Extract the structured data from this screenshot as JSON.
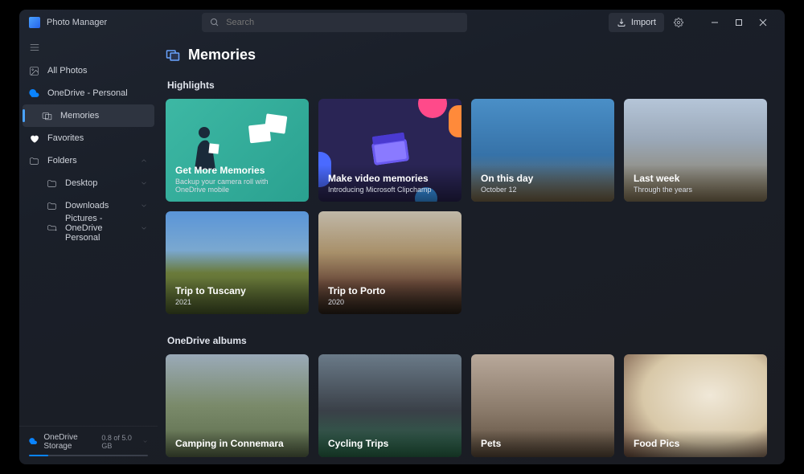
{
  "app": {
    "title": "Photo Manager"
  },
  "search": {
    "placeholder": "Search"
  },
  "toolbar": {
    "import": "Import"
  },
  "sidebar": {
    "all_photos": "All Photos",
    "onedrive": "OneDrive - Personal",
    "memories": "Memories",
    "favorites": "Favorites",
    "folders": "Folders",
    "desktop": "Desktop",
    "downloads": "Downloads",
    "pictures": "Pictures - OneDrive Personal"
  },
  "storage": {
    "label": "OneDrive Storage",
    "value": "0.8 of 5.0 GB",
    "percent": 16
  },
  "page": {
    "title": "Memories"
  },
  "sections": {
    "highlights": "Highlights",
    "albums": "OneDrive albums"
  },
  "highlights": [
    {
      "title": "Get More Memories",
      "sub": "Backup your camera roll with OneDrive mobile"
    },
    {
      "title": "Make video memories",
      "sub": "Introducing Microsoft Clipchamp"
    },
    {
      "title": "On this day",
      "sub": "October 12"
    },
    {
      "title": "Last week",
      "sub": "Through the years"
    },
    {
      "title": "Trip to Tuscany",
      "sub": "2021"
    },
    {
      "title": "Trip to Porto",
      "sub": "2020"
    }
  ],
  "albums": [
    {
      "title": "Camping in Connemara"
    },
    {
      "title": "Cycling Trips"
    },
    {
      "title": "Pets"
    },
    {
      "title": "Food Pics"
    }
  ]
}
